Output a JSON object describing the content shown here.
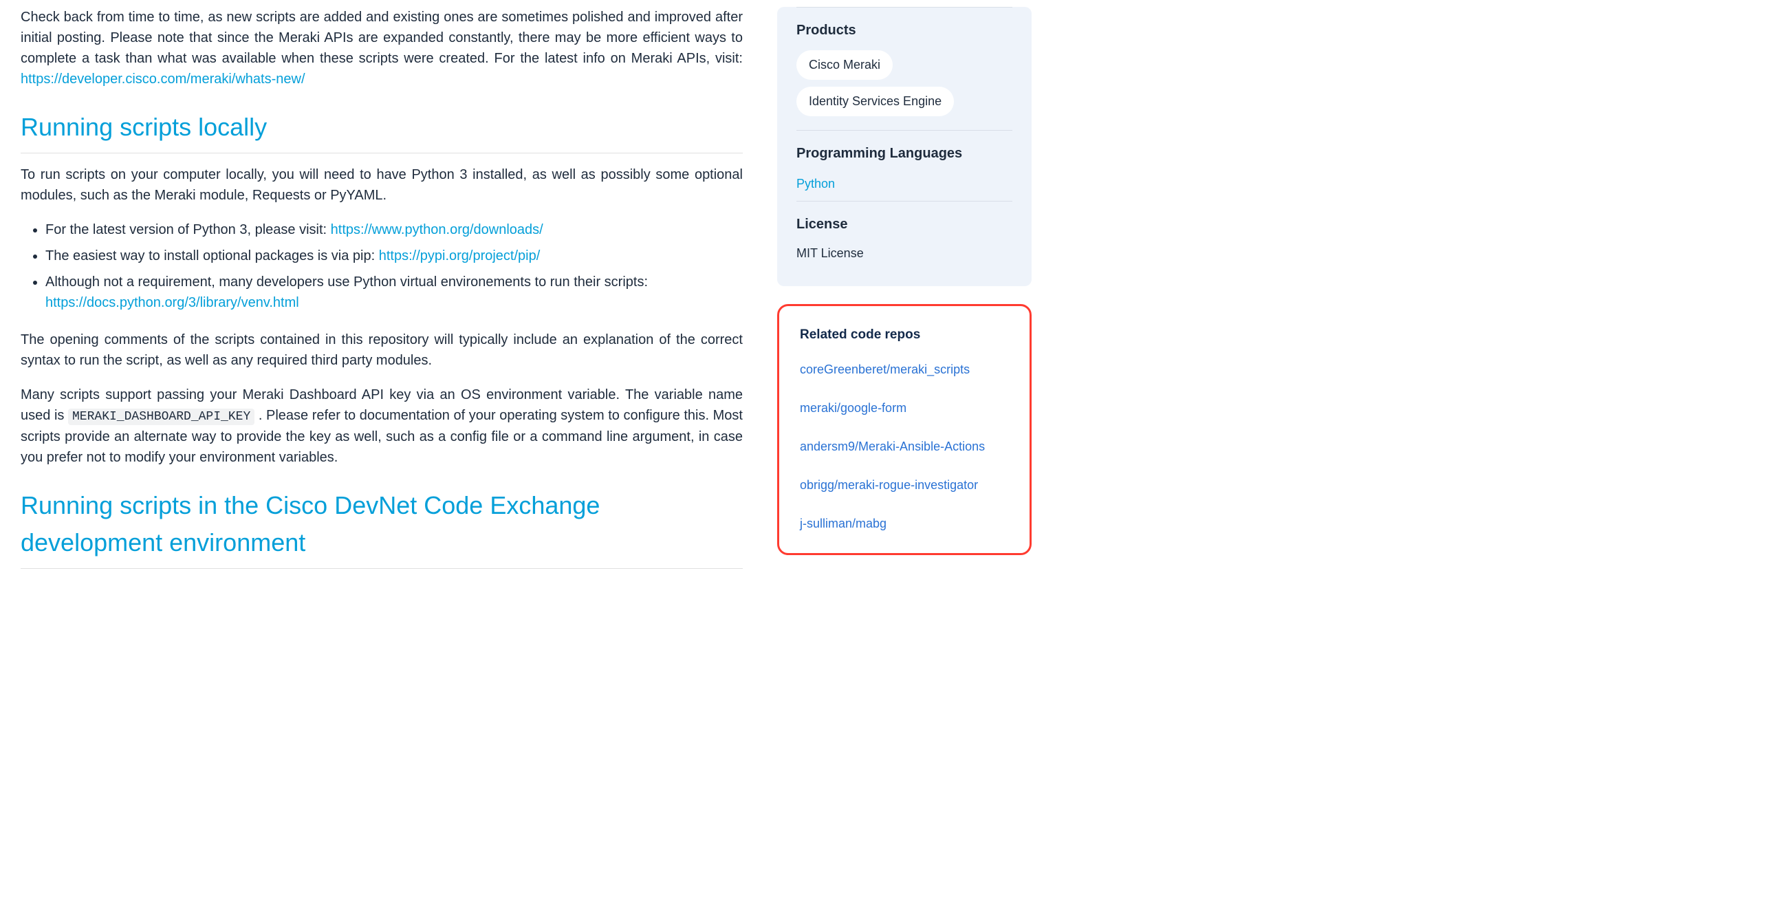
{
  "main": {
    "intro_text": "Check back from time to time, as new scripts are added and existing ones are sometimes polished and improved after initial posting. Please note that since the Meraki APIs are expanded constantly, there may be more efficient ways to complete a task than what was available when these scripts were created. For the latest info on Meraki APIs, visit: ",
    "intro_link": "https://developer.cisco.com/meraki/whats-new/",
    "heading_local": "Running scripts locally",
    "local_p1": "To run scripts on your computer locally, you will need to have Python 3 installed, as well as possibly some optional modules, such as the Meraki module, Requests or PyYAML.",
    "bullets": {
      "b1_text": "For the latest version of Python 3, please visit: ",
      "b1_link": "https://www.python.org/downloads/",
      "b2_text": "The easiest way to install optional packages is via pip: ",
      "b2_link": "https://pypi.org/project/pip/",
      "b3_text": "Although not a requirement, many developers use Python virtual environements to run their scripts: ",
      "b3_link": "https://docs.python.org/3/library/venv.html"
    },
    "local_p2": "The opening comments of the scripts contained in this repository will typically include an explanation of the correct syntax to run the script, as well as any required third party modules.",
    "local_p3a": "Many scripts support passing your Meraki Dashboard API key via an OS environment variable. The variable name used is ",
    "env_var": "MERAKI_DASHBOARD_API_KEY",
    "local_p3b": ". Please refer to documentation of your operating system to configure this. Most scripts provide an alternate way to provide the key as well, such as a config file or a command line argument, in case you prefer not to modify your environment variables.",
    "heading_devnet": "Running scripts in the Cisco DevNet Code Exchange development environment"
  },
  "sidebar": {
    "products_heading": "Products",
    "products": [
      "Cisco Meraki",
      "Identity Services Engine"
    ],
    "lang_heading": "Programming Languages",
    "lang_link": "Python",
    "license_heading": "License",
    "license_value": "MIT License",
    "related_heading": "Related code repos",
    "related": [
      "coreGreenberet/meraki_scripts",
      "meraki/google-form",
      "andersm9/Meraki-Ansible-Actions",
      "obrigg/meraki-rogue-investigator",
      "j-sulliman/mabg"
    ]
  }
}
